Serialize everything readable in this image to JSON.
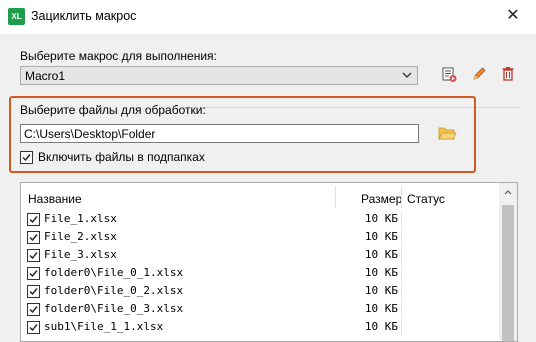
{
  "window": {
    "app_badge": "XL",
    "title": "Зациклить макрос",
    "close_glyph": "✕"
  },
  "macro": {
    "label": "Выберите макрос для выполнения:",
    "selected": "Macro1",
    "tools": [
      "run-macro-icon",
      "pencil-icon",
      "trash-icon"
    ]
  },
  "files": {
    "label": "Выберите файлы для обработки:",
    "path": "C:\\Users\\Desktop\\Folder",
    "include_subfolders_label": "Включить файлы в подпапках",
    "include_subfolders_checked": true,
    "highlight_color": "#d35a1e"
  },
  "file_list": {
    "columns": [
      "Название",
      "Размер",
      "Статус"
    ],
    "rows": [
      {
        "name": "File_1.xlsx",
        "size": "10 КБ",
        "status": "",
        "checked": true
      },
      {
        "name": "File_2.xlsx",
        "size": "10 КБ",
        "status": "",
        "checked": true
      },
      {
        "name": "File_3.xlsx",
        "size": "10 КБ",
        "status": "",
        "checked": true
      },
      {
        "name": "folder0\\File_0_1.xlsx",
        "size": "10 КБ",
        "status": "",
        "checked": true
      },
      {
        "name": "folder0\\File_0_2.xlsx",
        "size": "10 КБ",
        "status": "",
        "checked": true
      },
      {
        "name": "folder0\\File_0_3.xlsx",
        "size": "10 КБ",
        "status": "",
        "checked": true
      },
      {
        "name": "sub1\\File_1_1.xlsx",
        "size": "10 КБ",
        "status": "",
        "checked": true
      }
    ]
  }
}
